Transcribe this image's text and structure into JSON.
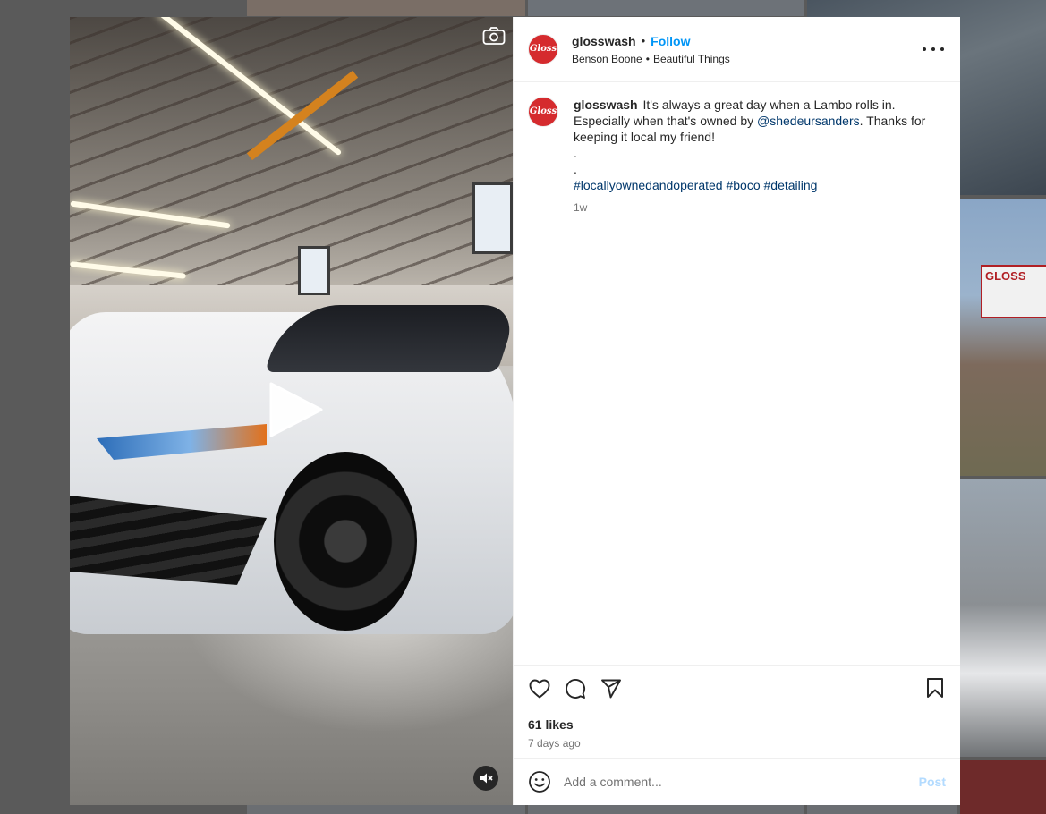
{
  "post": {
    "username": "glosswash",
    "avatar_text": "Gloss",
    "follow_label": "Follow",
    "music_artist": "Benson Boone",
    "music_track": "Beautiful Things",
    "caption": {
      "part1": "It's always a great day when a Lambo rolls in. Especially when that's owned by ",
      "mention": "@shedeursanders",
      "part2": ". Thanks for keeping it local my friend!",
      "dot1": ".",
      "dot2": ".",
      "hashtags": [
        "#locallyownedandoperated",
        "#boco",
        "#detailing"
      ]
    },
    "caption_time": "1w",
    "likes": "61 likes",
    "posted_ago": "7 days ago"
  },
  "comment": {
    "placeholder": "Add a comment...",
    "post_label": "Post"
  },
  "background": {
    "sign_text": "GLOSS"
  },
  "colors": {
    "follow": "#0095f6",
    "link": "#00376b",
    "post_disabled": "#b3dbff",
    "avatar": "#d52b2e"
  },
  "icons": {
    "camera": "camera-icon",
    "play": "play-icon",
    "mute": "speaker-muted-icon",
    "more": "more-options-icon",
    "like": "heart-icon",
    "comment": "comment-bubble-icon",
    "share": "paper-plane-icon",
    "save": "bookmark-icon",
    "emoji": "smiley-icon"
  }
}
